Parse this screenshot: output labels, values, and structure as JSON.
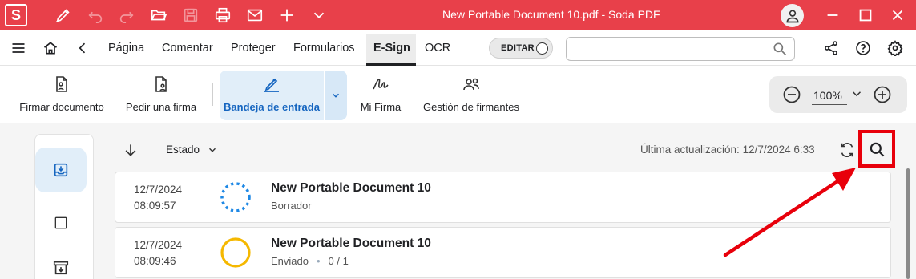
{
  "window": {
    "title": "New Portable Document 10.pdf  -  Soda PDF",
    "app_logo_letter": "S",
    "toolbar_icons": [
      "pen-icon",
      "undo-icon",
      "redo-icon",
      "open-folder-icon",
      "save-icon",
      "print-icon",
      "mail-icon",
      "plus-icon",
      "chevron-down-icon"
    ],
    "controls": [
      "user-icon",
      "minimize-icon",
      "maximize-icon",
      "close-icon"
    ]
  },
  "menu": {
    "items": [
      "Página",
      "Comentar",
      "Proteger",
      "Formularios",
      "E-Sign",
      "OCR"
    ],
    "active": "E-Sign",
    "edit_toggle_label": "EDITAR",
    "search_placeholder": ""
  },
  "ribbon": {
    "buttons": [
      {
        "label": "Firmar documento",
        "icon": "sign-document-icon"
      },
      {
        "label": "Pedir una firma",
        "icon": "request-signature-icon"
      },
      {
        "label": "Bandeja de entrada",
        "icon": "inbox-pen-icon",
        "active": true
      },
      {
        "label": "Mi Firma",
        "icon": "signature-icon"
      },
      {
        "label": "Gestión de firmantes",
        "icon": "signers-icon"
      }
    ],
    "zoom": "100%"
  },
  "list": {
    "filter_label": "Estado",
    "last_update_label": "Última actualización:",
    "last_update_value": "12/7/2024 6:33",
    "rows": [
      {
        "date": "12/7/2024",
        "time": "08:09:57",
        "title": "New Portable Document 10",
        "status": "Borrador",
        "status_icon": "draft-status-icon"
      },
      {
        "date": "12/7/2024",
        "time": "08:09:46",
        "title": "New Portable Document 10",
        "status": "Enviado",
        "signed_count": "0",
        "signers_total": "1",
        "status_icon": "sent-status-icon"
      }
    ]
  },
  "colors": {
    "brand": "#e8404a",
    "accent": "#1565c0",
    "annotation": "#e8000b",
    "sent_status": "#f5b800",
    "draft_status": "#1e88e5"
  }
}
